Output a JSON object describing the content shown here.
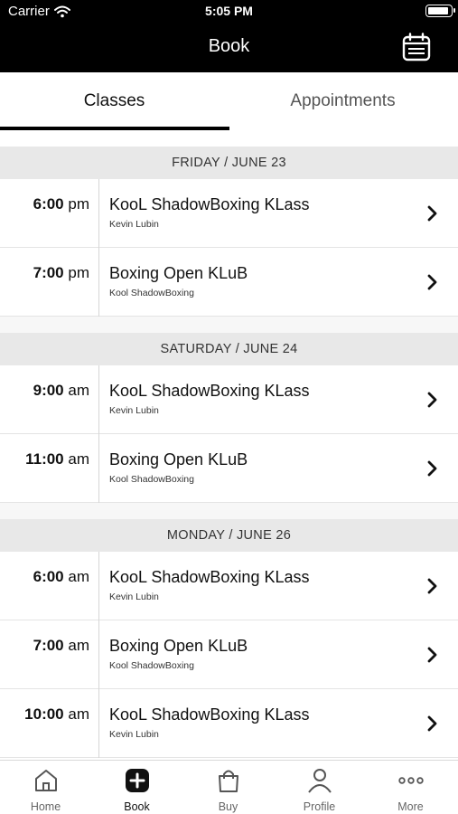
{
  "status_bar": {
    "carrier": "Carrier",
    "time": "5:05 PM"
  },
  "header": {
    "title": "Book",
    "icons": {
      "calendar": "calendar-icon"
    }
  },
  "tabs": [
    {
      "label": "Classes",
      "active": true
    },
    {
      "label": "Appointments",
      "active": false
    }
  ],
  "days": [
    {
      "header": "FRIDAY / JUNE 23",
      "classes": [
        {
          "time": "6:00",
          "ampm": "pm",
          "name": "KooL ShadowBoxing KLass",
          "instructor": "Kevin Lubin"
        },
        {
          "time": "7:00",
          "ampm": "pm",
          "name": "Boxing Open KLuB",
          "instructor": "Kool ShadowBoxing"
        }
      ]
    },
    {
      "header": "SATURDAY / JUNE 24",
      "classes": [
        {
          "time": "9:00",
          "ampm": "am",
          "name": "KooL ShadowBoxing KLass",
          "instructor": "Kevin Lubin"
        },
        {
          "time": "11:00",
          "ampm": "am",
          "name": "Boxing Open KLuB",
          "instructor": "Kool ShadowBoxing"
        }
      ]
    },
    {
      "header": "MONDAY / JUNE 26",
      "classes": [
        {
          "time": "6:00",
          "ampm": "am",
          "name": "KooL ShadowBoxing KLass",
          "instructor": "Kevin Lubin"
        },
        {
          "time": "7:00",
          "ampm": "am",
          "name": "Boxing Open KLuB",
          "instructor": "Kool ShadowBoxing"
        },
        {
          "time": "10:00",
          "ampm": "am",
          "name": "KooL ShadowBoxing KLass",
          "instructor": "Kevin Lubin"
        }
      ]
    }
  ],
  "tabbar": [
    {
      "label": "Home",
      "icon": "home-icon",
      "active": false
    },
    {
      "label": "Book",
      "icon": "plus-square-icon",
      "active": true
    },
    {
      "label": "Buy",
      "icon": "shopping-bag-icon",
      "active": false
    },
    {
      "label": "Profile",
      "icon": "profile-icon",
      "active": false
    },
    {
      "label": "More",
      "icon": "more-icon",
      "active": false
    }
  ],
  "colors": {
    "header_bg": "#000000",
    "day_header_bg": "#e8e8e8",
    "active_tab": "#111111",
    "inactive_tab": "#666666"
  }
}
